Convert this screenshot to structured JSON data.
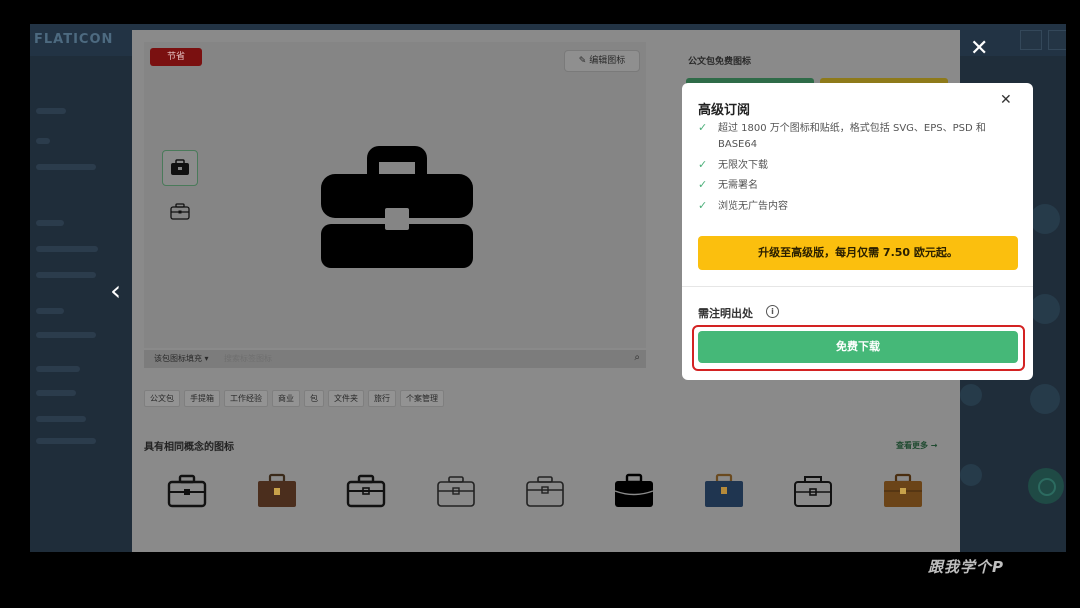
{
  "background": {
    "logo": "FLATICON",
    "prev_arrow": "‹",
    "close_overlay": "✕"
  },
  "modal": {
    "badge": "节省",
    "edit_icon_label": "编辑图标",
    "right_panel_title": "公文包免费图标",
    "search_select": "该包图标填充 ▾",
    "search_placeholder": "搜索标签图标",
    "tags": [
      "公文包",
      "手提箱",
      "工作经验",
      "商业",
      "包",
      "文件夹",
      "旅行",
      "个案管理"
    ],
    "related_title": "具有相同概念的图标",
    "see_more": "查看更多 →"
  },
  "card": {
    "title": "高级订阅",
    "features": [
      "超过 1800 万个图标和贴纸，格式包括 SVG、EPS、PSD 和 BASE64",
      "无限次下载",
      "无需署名",
      "浏览无广告内容"
    ],
    "upgrade_label": "升级至高级版，每月仅需 7.50 欧元起。",
    "attribution_label": "需注明出处",
    "download_label": "免费下载"
  },
  "watermark": "跟我学个P",
  "colors": {
    "green": "#45b878",
    "yellow": "#fbbf0e",
    "highlight": "#d32222"
  }
}
